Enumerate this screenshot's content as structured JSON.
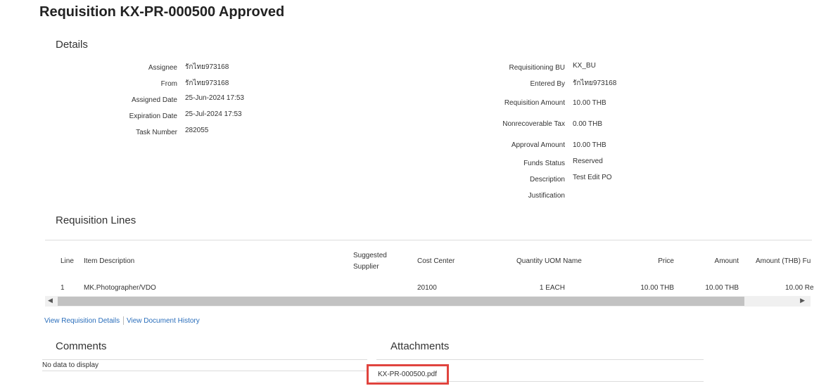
{
  "title": "Requisition KX-PR-000500 Approved",
  "details": {
    "heading": "Details",
    "left": [
      {
        "label": "Assignee",
        "value": "รักไทย973168"
      },
      {
        "label": "From",
        "value": "รักไทย973168"
      },
      {
        "label": "Assigned Date",
        "value": "25-Jun-2024 17:53"
      },
      {
        "label": "Expiration Date",
        "value": "25-Jul-2024 17:53"
      },
      {
        "label": "Task Number",
        "value": "282055"
      }
    ],
    "right": [
      {
        "label": "Requisitioning BU",
        "value": "KX_BU"
      },
      {
        "label": "Entered By",
        "value": "รักไทย973168"
      },
      {
        "label": "Requisition Amount",
        "value": "10.00 THB"
      },
      {
        "label": "Nonrecoverable Tax",
        "value": "0.00 THB"
      },
      {
        "label": "Approval Amount",
        "value": "10.00 THB"
      },
      {
        "label": "Funds Status",
        "value": "Reserved"
      },
      {
        "label": "Description",
        "value": "Test Edit PO"
      },
      {
        "label": "Justification",
        "value": ""
      }
    ]
  },
  "lines": {
    "heading": "Requisition Lines",
    "columns": [
      "Line",
      "Item Description",
      "Suggested",
      "Supplier",
      "Cost Center",
      "Quantity UOM Name",
      "Price",
      "Amount",
      "Amount (THB) Fu"
    ],
    "row": [
      "1",
      "MK.Photographer/VDO",
      "",
      "20100",
      "1 EACH",
      "10.00 THB",
      "10.00 THB",
      "10.00 Re"
    ]
  },
  "links": {
    "details": "View Requisition Details",
    "history": "View Document History"
  },
  "comments": {
    "heading": "Comments",
    "empty": "No data to display"
  },
  "attachments": {
    "heading": "Attachments",
    "file": "KX-PR-000500.pdf"
  }
}
